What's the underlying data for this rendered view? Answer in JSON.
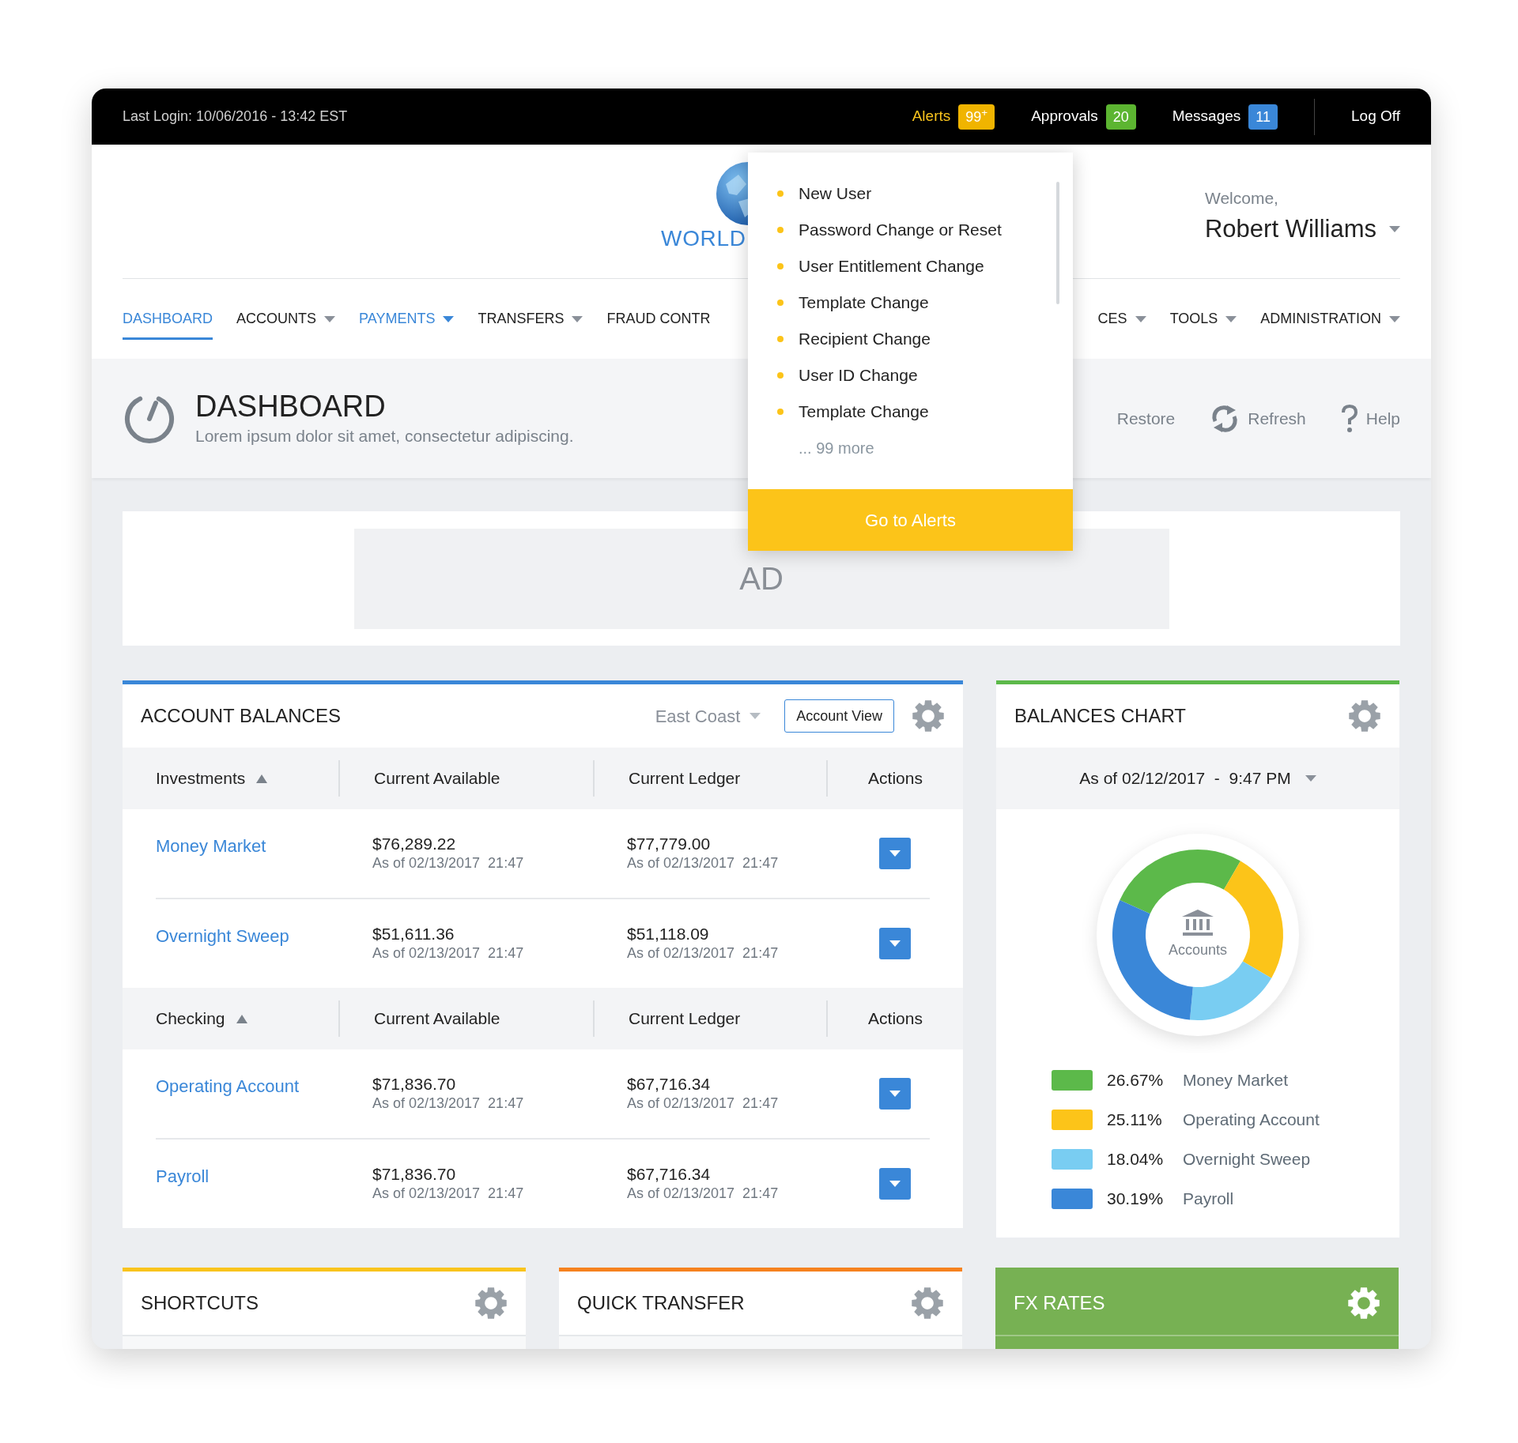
{
  "top_bar": {
    "last_login": "Last Login: 10/06/2016 - 13:42 EST",
    "items": [
      {
        "label": "Alerts",
        "badge": "99$^{+}$",
        "color": "#f0b400",
        "selected": true
      },
      {
        "label": "Approvals",
        "badge": "20",
        "color": "#5cb531",
        "selected": false
      },
      {
        "label": "Messages",
        "badge": "11",
        "color": "#3a87d8",
        "selected": false
      }
    ],
    "log_off": "Log Off"
  },
  "header": {
    "logo_text": "WORLD",
    "welcome": "Welcome,",
    "user_name": "Robert Williams"
  },
  "nav": [
    {
      "label": "DASHBOARD",
      "selected": true,
      "highlighted": false,
      "dropdown": false
    },
    {
      "label": "ACCOUNTS",
      "selected": false,
      "highlighted": false,
      "dropdown": true
    },
    {
      "label": "PAYMENTS",
      "selected": false,
      "highlighted": true,
      "dropdown": true
    },
    {
      "label": "TRANSFERS",
      "selected": false,
      "highlighted": false,
      "dropdown": true
    },
    {
      "label": "FRAUD CONTR",
      "selected": false,
      "highlighted": false,
      "dropdown": false
    },
    {
      "label": "CES",
      "selected": false,
      "highlighted": false,
      "dropdown": true
    },
    {
      "label": "TOOLS",
      "selected": false,
      "highlighted": false,
      "dropdown": true
    },
    {
      "label": "ADMINISTRATION",
      "selected": false,
      "highlighted": false,
      "dropdown": true
    }
  ],
  "alerts_menu": {
    "items": [
      "New User",
      "Password Change or Reset",
      "User Entitlement Change",
      "Template Change",
      "Recipient Change",
      "User ID Change",
      "Template Change"
    ],
    "more": "... 99 more",
    "button": "Go to Alerts"
  },
  "page_header": {
    "title": "DASHBOARD",
    "subtitle": "Lorem ipsum dolor sit amet, consectetur adipiscing.",
    "actions": [
      {
        "kind": "restore",
        "label": "Restore"
      },
      {
        "kind": "refresh",
        "label": "Refresh"
      },
      {
        "kind": "help",
        "label": "Help"
      }
    ]
  },
  "ad": {
    "label": "AD"
  },
  "account_balances": {
    "title": "ACCOUNT BALANCES",
    "region": "East Coast",
    "view_button": "Account View",
    "groups": [
      {
        "name": "Investments",
        "columns": [
          "Current Available",
          "Current Ledger",
          "Actions"
        ],
        "rows": [
          {
            "account": "Money Market",
            "available": "$76,289.22",
            "available_as_of": "As of 02/13/2017  21:47",
            "ledger": "$77,779.00",
            "ledger_as_of": "As of 02/13/2017  21:47"
          },
          {
            "account": "Overnight Sweep",
            "available": "$51,611.36",
            "available_as_of": "As of 02/13/2017  21:47",
            "ledger": "$51,118.09",
            "ledger_as_of": "As of 02/13/2017  21:47"
          }
        ]
      },
      {
        "name": "Checking",
        "columns": [
          "Current Available",
          "Current Ledger",
          "Actions"
        ],
        "rows": [
          {
            "account": "Operating Account",
            "available": "$71,836.70",
            "available_as_of": "As of 02/13/2017  21:47",
            "ledger": "$67,716.34",
            "ledger_as_of": "As of 02/13/2017  21:47"
          },
          {
            "account": "Payroll",
            "available": "$71,836.70",
            "available_as_of": "As of 02/13/2017  21:47",
            "ledger": "$67,716.34",
            "ledger_as_of": "As of 02/13/2017  21:47"
          }
        ]
      }
    ]
  },
  "balances_chart": {
    "title": "BALANCES CHART",
    "date": "As of 02/12/2017  -  9:47 PM",
    "center_label": "Accounts",
    "chart_data": {
      "type": "donut",
      "categories": [
        "Money Market",
        "Operating Account",
        "Overnight Sweep",
        "Payroll"
      ],
      "values": [
        26.67,
        25.11,
        18.04,
        30.19
      ]
    },
    "legend": [
      {
        "color": "#5cb94a",
        "percent": "26.67%"
      },
      {
        "color": "#fcc419",
        "percent": "25.11%"
      },
      {
        "color": "#79cdf2",
        "percent": "18.04%"
      },
      {
        "color": "#3a87d8",
        "percent": "30.19%"
      }
    ]
  },
  "widgets": [
    {
      "title": "SHORTCUTS",
      "color": "#f9c41d",
      "filled": false
    },
    {
      "title": "QUICK TRANSFER",
      "color": "#f6821f",
      "filled": false
    },
    {
      "title": "FX RATES",
      "color": "#77b153",
      "filled": true
    }
  ]
}
